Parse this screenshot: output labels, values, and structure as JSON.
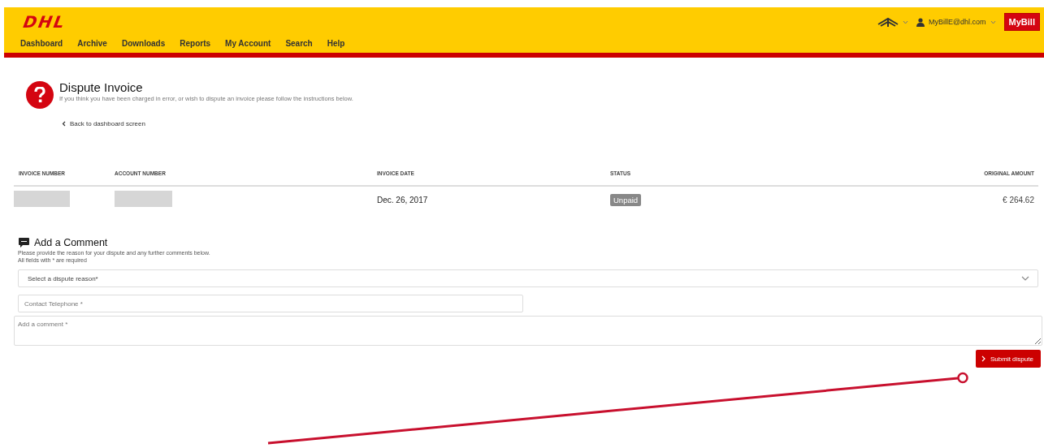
{
  "header": {
    "logo": "DHL",
    "user_email": "MyBillE@dhl.com",
    "app_button": "MyBill"
  },
  "nav": [
    "Dashboard",
    "Archive",
    "Downloads",
    "Reports",
    "My Account",
    "Search",
    "Help"
  ],
  "page": {
    "title": "Dispute Invoice",
    "subtitle": "If you think you have been charged in error, or wish to dispute an invoice please follow the instructions below.",
    "back_link": "Back to dashboard screen"
  },
  "invoice_table": {
    "columns": [
      "INVOICE NUMBER",
      "ACCOUNT NUMBER",
      "INVOICE DATE",
      "STATUS",
      "ORIGINAL AMOUNT"
    ],
    "row": {
      "invoice_number_redacted": true,
      "account_number_redacted": true,
      "invoice_date": "Dec. 26, 2017",
      "status": "Unpaid",
      "original_amount": "€ 264.62"
    }
  },
  "comment_section": {
    "title": "Add a Comment",
    "description": "Please provide the reason for your dispute and any further comments below.",
    "required_note": "All fields with * are required",
    "fields": [
      {
        "kind": "select",
        "placeholder": "Select a dispute reason*"
      },
      {
        "kind": "input",
        "placeholder": "Contact Telephone *"
      },
      {
        "kind": "textarea",
        "placeholder": "Add a comment *"
      }
    ],
    "submit_button": "Submit dispute"
  }
}
